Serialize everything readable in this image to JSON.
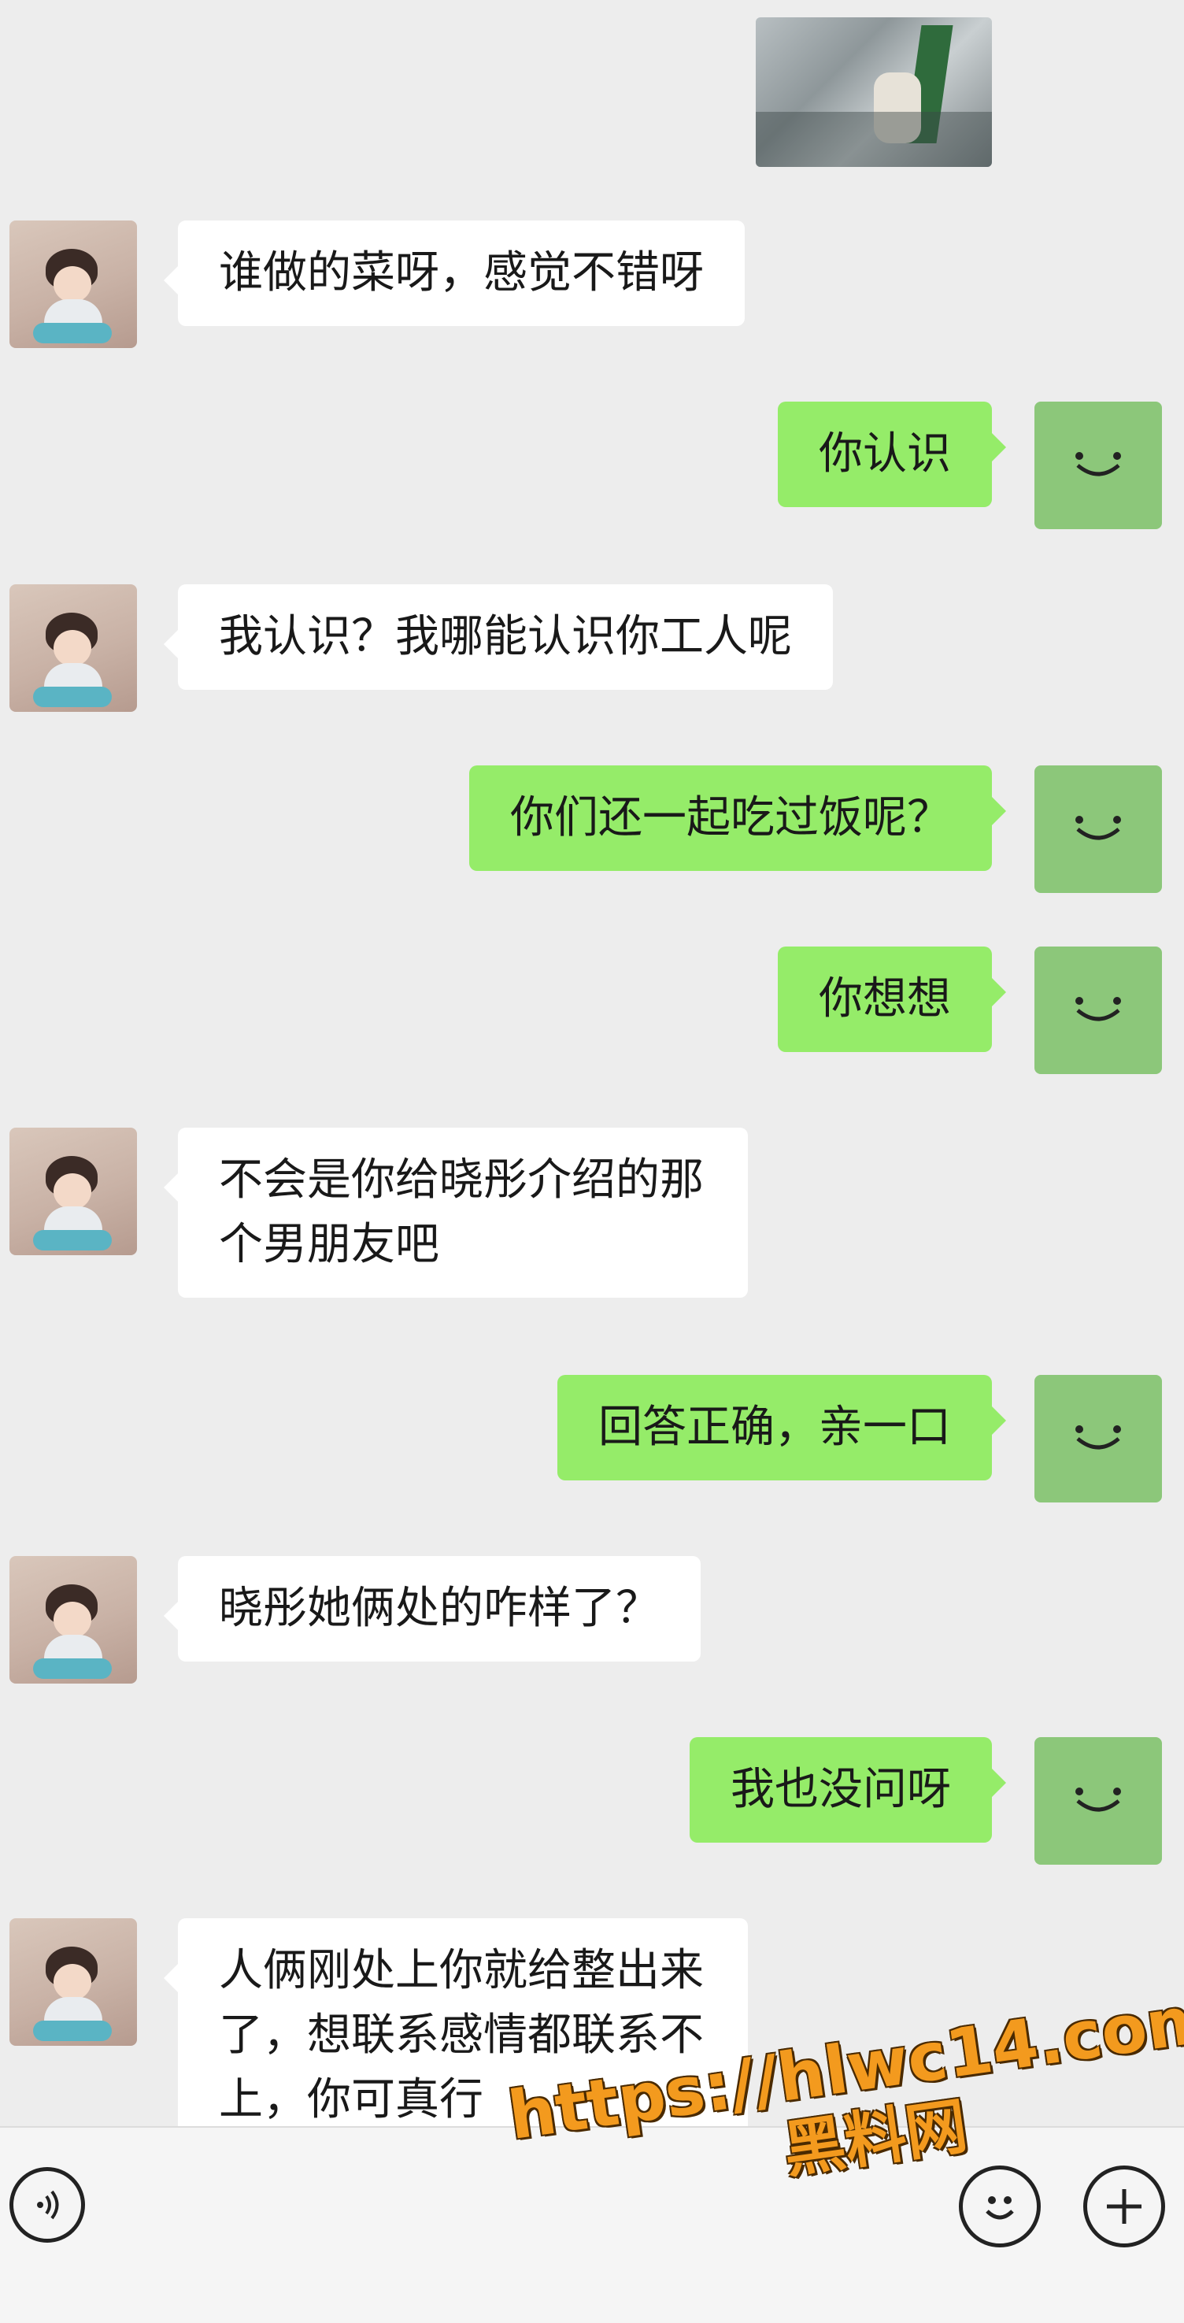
{
  "messages": [
    {
      "side": "in",
      "text": "谁做的菜呀，感觉不错呀"
    },
    {
      "side": "out",
      "text": "你认识"
    },
    {
      "side": "in",
      "text": "我认识？我哪能认识你工人呢"
    },
    {
      "side": "out",
      "text": "你们还一起吃过饭呢？"
    },
    {
      "side": "out",
      "text": "你想想"
    },
    {
      "side": "in",
      "text": "不会是你给晓彤介绍的那个男朋友吧"
    },
    {
      "side": "out",
      "text": "回答正确，亲一口"
    },
    {
      "side": "in",
      "text": "晓彤她俩处的咋样了？"
    },
    {
      "side": "out",
      "text": "我也没问呀"
    },
    {
      "side": "in",
      "text": "人俩刚处上你就给整出来了，想联系感情都联系不上，你可真行"
    }
  ],
  "watermark": {
    "url": "https://hlwc14.com",
    "brand": "黑料网"
  },
  "colors": {
    "background": "#ededed",
    "outgoing_bubble": "#95ec69",
    "incoming_bubble": "#ffffff",
    "watermark": "#f39a1e"
  },
  "icons": {
    "voice": "voice-icon",
    "emoji": "emoji-icon",
    "plus": "plus-icon",
    "self_avatar": "smile-avatar-icon"
  }
}
